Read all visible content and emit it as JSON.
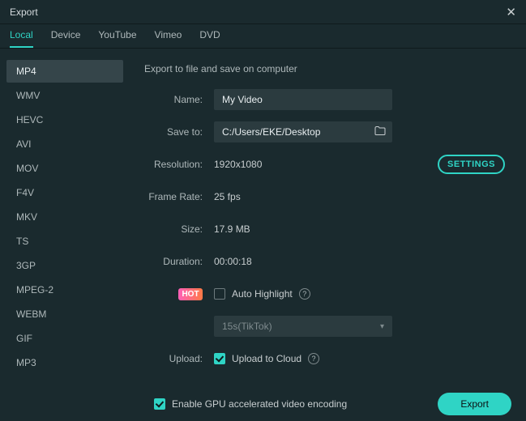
{
  "window": {
    "title": "Export"
  },
  "tabs": [
    {
      "id": "local",
      "label": "Local",
      "active": true
    },
    {
      "id": "device",
      "label": "Device",
      "active": false
    },
    {
      "id": "youtube",
      "label": "YouTube",
      "active": false
    },
    {
      "id": "vimeo",
      "label": "Vimeo",
      "active": false
    },
    {
      "id": "dvd",
      "label": "DVD",
      "active": false
    }
  ],
  "sidebar": {
    "items": [
      {
        "label": "MP4",
        "active": true
      },
      {
        "label": "WMV",
        "active": false
      },
      {
        "label": "HEVC",
        "active": false
      },
      {
        "label": "AVI",
        "active": false
      },
      {
        "label": "MOV",
        "active": false
      },
      {
        "label": "F4V",
        "active": false
      },
      {
        "label": "MKV",
        "active": false
      },
      {
        "label": "TS",
        "active": false
      },
      {
        "label": "3GP",
        "active": false
      },
      {
        "label": "MPEG-2",
        "active": false
      },
      {
        "label": "WEBM",
        "active": false
      },
      {
        "label": "GIF",
        "active": false
      },
      {
        "label": "MP3",
        "active": false
      }
    ]
  },
  "main": {
    "section_title": "Export to file and save on computer",
    "labels": {
      "name": "Name:",
      "save_to": "Save to:",
      "resolution": "Resolution:",
      "frame_rate": "Frame Rate:",
      "size": "Size:",
      "duration": "Duration:",
      "upload": "Upload:"
    },
    "values": {
      "name": "My Video",
      "save_to": "C:/Users/EKE/Desktop",
      "resolution": "1920x1080",
      "frame_rate": "25 fps",
      "size": "17.9 MB",
      "duration": "00:00:18"
    },
    "settings_button": "SETTINGS",
    "hot_badge": "HOT",
    "auto_highlight": {
      "label": "Auto Highlight",
      "checked": false
    },
    "preset_select": {
      "value": "15s(TikTok)"
    },
    "upload_cloud": {
      "label": "Upload to Cloud",
      "checked": true
    }
  },
  "footer": {
    "gpu": {
      "label": "Enable GPU accelerated video encoding",
      "checked": true
    },
    "export_button": "Export"
  }
}
